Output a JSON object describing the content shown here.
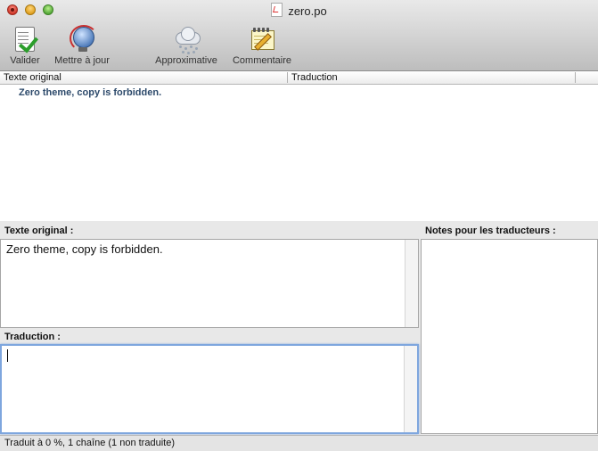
{
  "window": {
    "title": "zero.po"
  },
  "toolbar": [
    {
      "label": "Valider",
      "icon": "validate-icon"
    },
    {
      "label": "Mettre à jour",
      "icon": "update-globe-icon"
    },
    {
      "label": "Approximative",
      "icon": "fuzzy-cloud-icon"
    },
    {
      "label": "Commentaire",
      "icon": "comment-notepad-icon"
    }
  ],
  "list": {
    "columns": [
      "Texte original",
      "Traduction"
    ],
    "rows": [
      {
        "original": "Zero theme, copy is forbidden.",
        "translation": ""
      }
    ]
  },
  "editor": {
    "original_label": "Texte original :",
    "original_text": "Zero theme, copy is forbidden.",
    "translation_label": "Traduction :",
    "translation_text": "",
    "notes_label": "Notes pour les traducteurs :"
  },
  "status": {
    "text": "Traduit à 0 %, 1 chaîne (1 non traduite)"
  },
  "colors": {
    "source_text": "#2d4a6b",
    "focus_ring": "#7ea6de"
  }
}
